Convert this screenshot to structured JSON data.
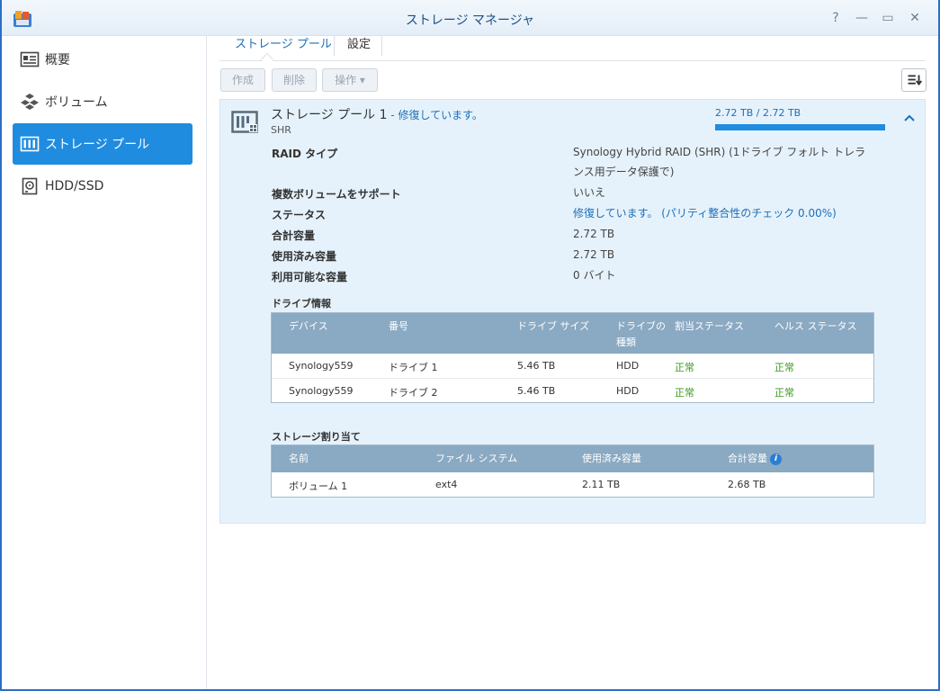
{
  "window": {
    "title": "ストレージ マネージャ",
    "controls": {
      "help": "?",
      "minimize": "—",
      "maximize": "▭",
      "close": "✕"
    }
  },
  "sidebar": {
    "items": [
      {
        "label": "概要",
        "icon": "overview-icon",
        "active": false
      },
      {
        "label": "ボリューム",
        "icon": "volume-icon",
        "active": false
      },
      {
        "label": "ストレージ プール",
        "icon": "storage-pool-icon",
        "active": true
      },
      {
        "label": "HDD/SSD",
        "icon": "hdd-icon",
        "active": false
      }
    ]
  },
  "tabs": [
    {
      "label": "ストレージ プール",
      "active": true
    },
    {
      "label": "設定",
      "active": false
    }
  ],
  "toolbar": {
    "create_label": "作成",
    "delete_label": "削除",
    "action_label": "操作 ▾"
  },
  "pool": {
    "name": "ストレージ プール 1",
    "status_text": " - 修復しています。",
    "type": "SHR",
    "usage_text": "2.72 TB / 2.72 TB",
    "usage_fraction": 1.0,
    "properties": [
      {
        "label": "RAID タイプ",
        "value": "Synology Hybrid RAID (SHR) (1ドライブ フォルト トレランス用データ保護で)"
      },
      {
        "label": "複数ボリュームをサポート",
        "value": "いいえ"
      },
      {
        "label": "ステータス",
        "value": "修復しています。 (パリティ整合性のチェック 0.00%)"
      },
      {
        "label": "合計容量",
        "value": "2.72 TB"
      },
      {
        "label": "使用済み容量",
        "value": "2.72 TB"
      },
      {
        "label": "利用可能な容量",
        "value": "0 バイト"
      }
    ]
  },
  "drive_info": {
    "section_label": "ドライブ情報",
    "headers": [
      "デバイス",
      "番号",
      "ドライブ サイズ",
      "ドライブの種類",
      "割当ステータス",
      "ヘルス ステータス"
    ],
    "rows": [
      [
        "Synology559",
        "ドライブ 1",
        "5.46 TB",
        "HDD",
        "正常",
        "正常"
      ],
      [
        "Synology559",
        "ドライブ 2",
        "5.46 TB",
        "HDD",
        "正常",
        "正常"
      ]
    ]
  },
  "allocation": {
    "section_label": "ストレージ割り当て",
    "headers": [
      "名前",
      "ファイル システム",
      "使用済み容量",
      "合計容量"
    ],
    "rows": [
      [
        "ボリューム 1",
        "ext4",
        "2.11 TB",
        "2.68 TB"
      ]
    ]
  },
  "colors": {
    "accent": "#1f8ce0",
    "link": "#1d6fb8",
    "ok": "#3a9a1e",
    "panel_bg": "#e6f2fb",
    "table_header": "#8aa9c2"
  }
}
